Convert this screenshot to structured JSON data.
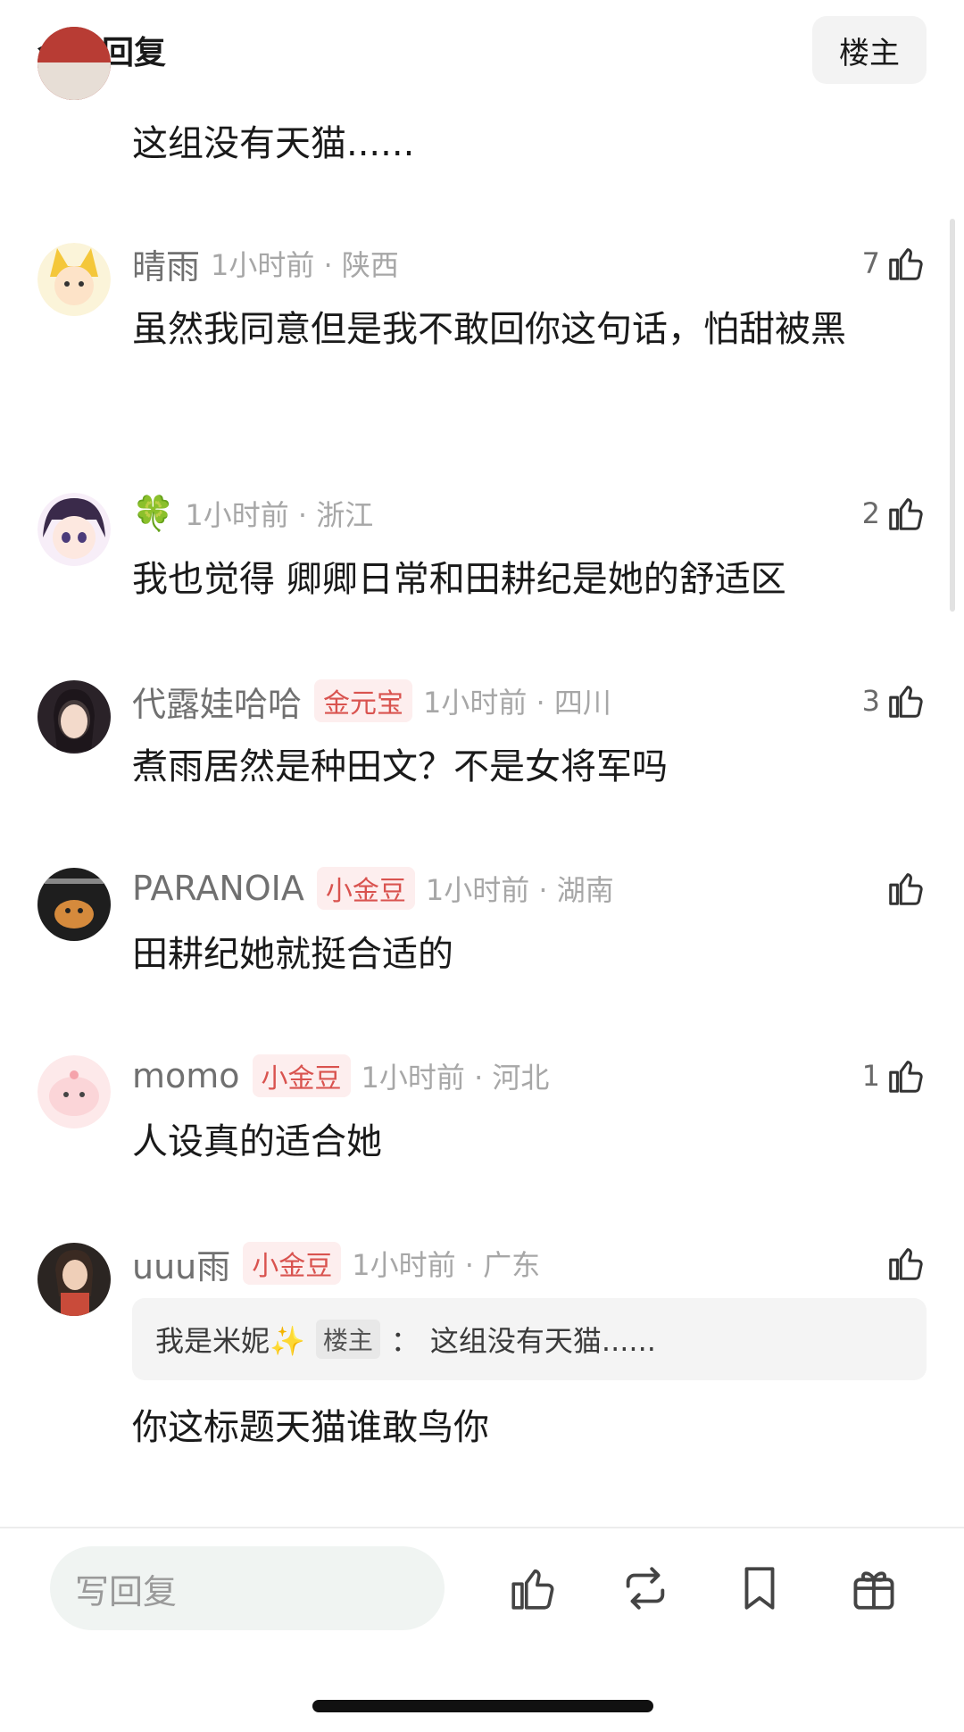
{
  "header": {
    "title": "全部回复",
    "op_label": "楼主"
  },
  "comments": [
    {
      "body": "这组没有天猫......"
    },
    {
      "user": "晴雨",
      "badge": "",
      "time": "1小时前 · 陕西",
      "likes": "7",
      "body": "虽然我同意但是我不敢回你这句话，怕甜被黑"
    },
    {
      "user": "🍀",
      "badge": "",
      "time": "1小时前 · 浙江",
      "likes": "2",
      "body": "我也觉得 卿卿日常和田耕纪是她的舒适区"
    },
    {
      "user": "代露娃哈哈",
      "badge": "金元宝",
      "time": "1小时前 · 四川",
      "likes": "3",
      "body": "煮雨居然是种田文？不是女将军吗"
    },
    {
      "user": "PARANOIA",
      "badge": "小金豆",
      "time": "1小时前 · 湖南",
      "likes": "",
      "body": "田耕纪她就挺合适的"
    },
    {
      "user": "momo",
      "badge": "小金豆",
      "time": "1小时前 · 河北",
      "likes": "1",
      "body": "人设真的适合她"
    },
    {
      "user": "uuu雨",
      "badge": "小金豆",
      "time": "1小时前 · 广东",
      "likes": "",
      "quote": {
        "user": "我是米妮✨",
        "tag": "楼主",
        "sep": "：",
        "text": "这组没有天猫......"
      },
      "body": "你这标题天猫谁敢鸟你"
    }
  ],
  "footer": {
    "reply_placeholder": "写回复",
    "icons": [
      "like-icon",
      "repost-icon",
      "bookmark-icon",
      "gift-icon"
    ]
  },
  "colors": {
    "badge_bg": "#fdeeee",
    "badge_text": "#d9534f",
    "reply_box_bg": "#f0f4f2"
  }
}
